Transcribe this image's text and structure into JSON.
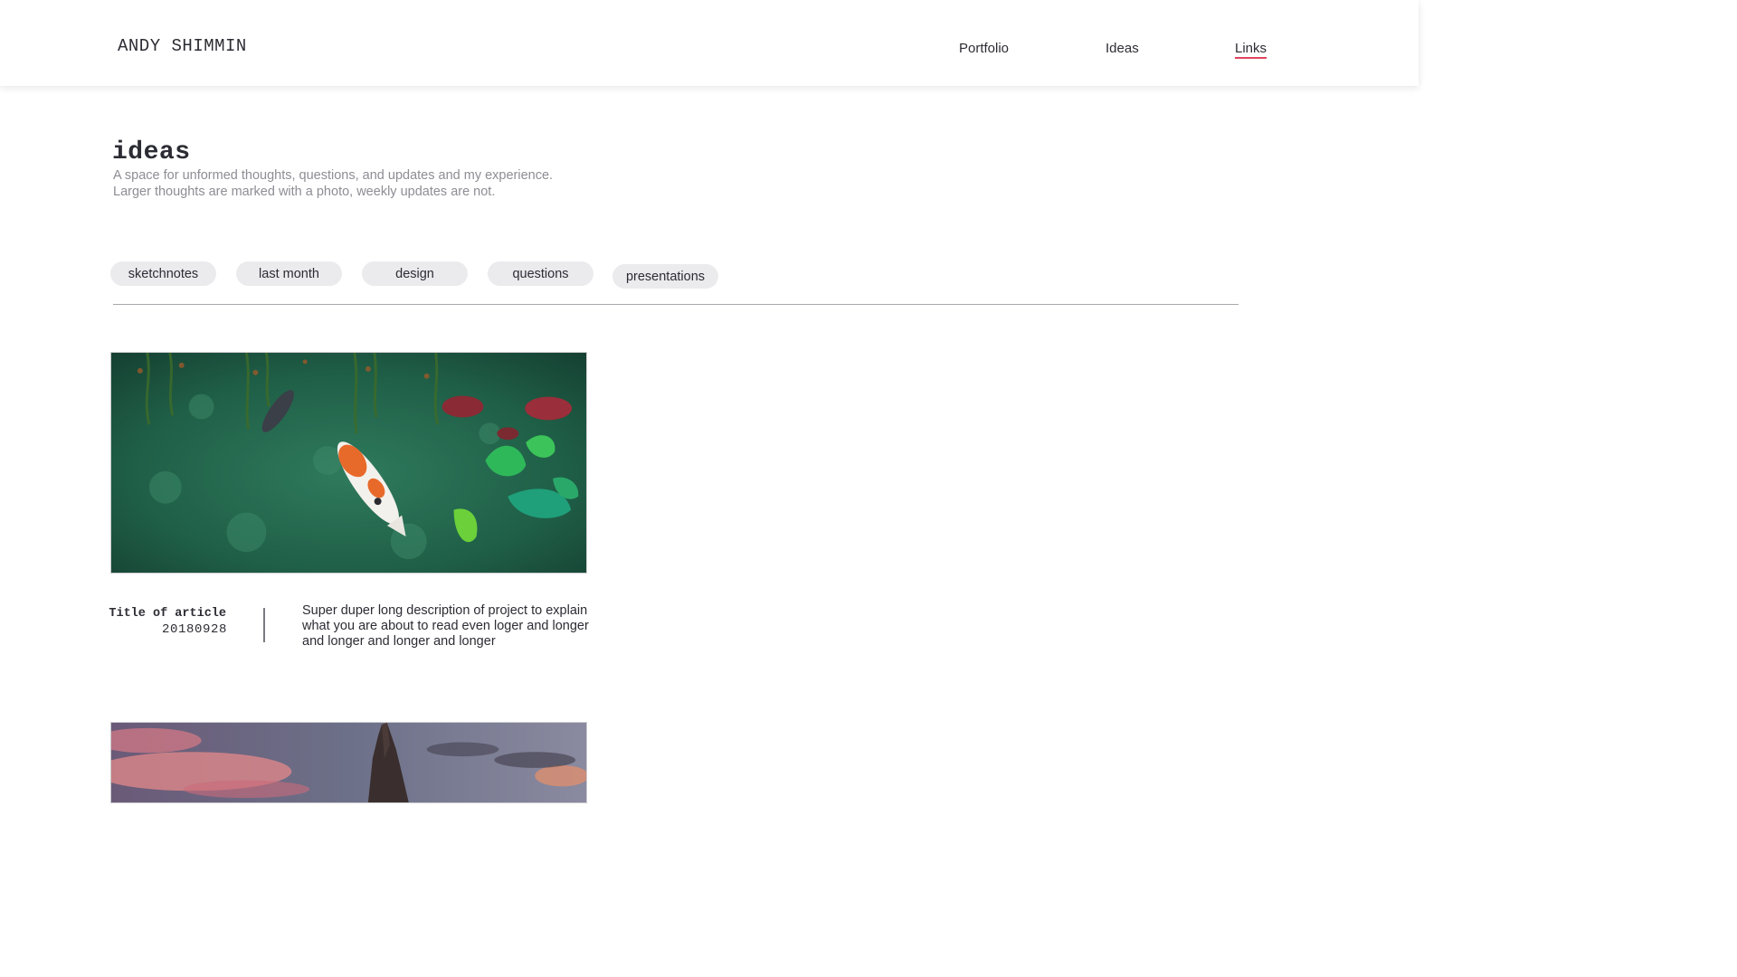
{
  "header": {
    "site_name": "ANDY SHIMMIN",
    "nav": [
      {
        "label": "Portfolio"
      },
      {
        "label": "Ideas"
      },
      {
        "label": "Links",
        "active": true
      }
    ]
  },
  "colors": {
    "accent": "#e0445e",
    "text": "#2c2c34",
    "muted": "#8d8d94",
    "tag_background": "#ebebee"
  },
  "page": {
    "title": "ideas",
    "intro_lines": [
      "A space for unformed thoughts, questions, and updates and my experience.",
      "Larger thoughts are marked with a photo, weekly updates are not."
    ]
  },
  "filters": [
    {
      "label": "sketchnotes"
    },
    {
      "label": "last month"
    },
    {
      "label": "design"
    },
    {
      "label": "questions"
    },
    {
      "label": "presentations"
    }
  ],
  "articles": [
    {
      "image": "koi-pond-photo",
      "title": "Title of article",
      "date": "20180928",
      "description_lines": [
        "Super duper long description of project to explain",
        "what you are about to read even loger and longer",
        "and longer and longer and longer"
      ]
    },
    {
      "image": "rock-spire-sunset-photo"
    }
  ]
}
